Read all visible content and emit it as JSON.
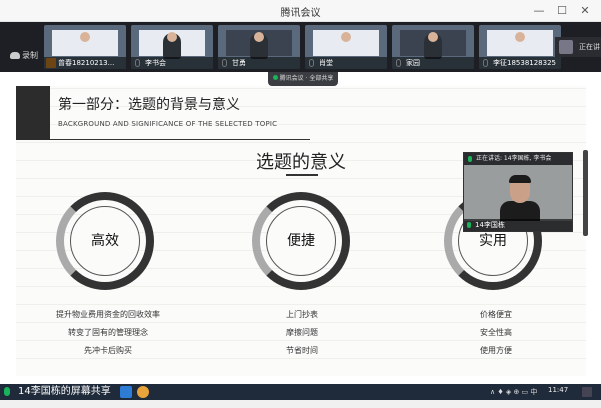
{
  "window": {
    "title": "腾讯会议",
    "min_glyph": "—",
    "max_glyph": "☐",
    "close_glyph": "✕"
  },
  "toolbar": {
    "record_label": "录制"
  },
  "participants": [
    {
      "name": "曾春18210213..."
    },
    {
      "name": "李书会"
    },
    {
      "name": "甘勇"
    },
    {
      "name": "肖堂"
    },
    {
      "name": "家园"
    },
    {
      "name": "李征18538128325"
    }
  ],
  "speaking_strip": {
    "label": "正在讲"
  },
  "share_banner": {
    "label": "腾讯会议 · 全部共享"
  },
  "slide": {
    "heading": "第一部分：选题的背景与意义",
    "subheading": "BACKGROUND AND SIGNIFICANCE OF THE SELECTED TOPIC",
    "center_title": "选题的意义",
    "rings": [
      "高效",
      "便捷",
      "实用"
    ],
    "columns": [
      [
        "提升物业费用资金的回收效率",
        "转变了固有的管理理念",
        "先冲卡后购买"
      ],
      [
        "上门抄表",
        "摩擦问题",
        "节省时间"
      ],
      [
        "价格便宜",
        "安全性高",
        "使用方便"
      ]
    ]
  },
  "speaker": {
    "header": "正在讲话: 14李国栋, 李书会",
    "name": "14李国栋"
  },
  "taskbar": {
    "share_label": "14李国栋的屏幕共享",
    "tray": "∧ ♦ ◈ ⊕ ▭ 中",
    "time": "11:47"
  },
  "colors": {
    "accent_green": "#19b35b",
    "slide_dark": "#2c2c2c",
    "strip_bg": "#1d1f24"
  }
}
